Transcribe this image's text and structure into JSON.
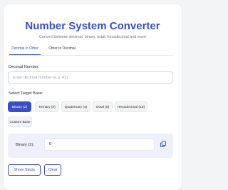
{
  "header": {
    "title": "Number System Converter",
    "subtitle": "Convert between decimal, binary, octal, hexadecimal and more"
  },
  "tabs": [
    {
      "label": "Decimal to Other",
      "active": true
    },
    {
      "label": "Other to Decimal",
      "active": false
    }
  ],
  "decimal_input": {
    "label": "Decimal Number:",
    "placeholder": "Enter decimal number (e.g. 42)",
    "value": ""
  },
  "target_base": {
    "label": "Select Target Base:",
    "options": [
      {
        "label": "Binary (2)",
        "selected": true
      },
      {
        "label": "Ternary (3)",
        "selected": false
      },
      {
        "label": "Quaternary (4)",
        "selected": false
      },
      {
        "label": "Octal (8)",
        "selected": false
      },
      {
        "label": "Hexadecimal (16)",
        "selected": false
      },
      {
        "label": "Custom Base",
        "selected": false
      }
    ]
  },
  "result": {
    "label": "Binary (2):",
    "value": "0",
    "copy_icon": "copy-icon"
  },
  "actions": {
    "show_steps": "Show Steps",
    "clear": "Clear"
  },
  "colors": {
    "accent": "#3b4fc4",
    "result_bg": "#eef0fb"
  }
}
